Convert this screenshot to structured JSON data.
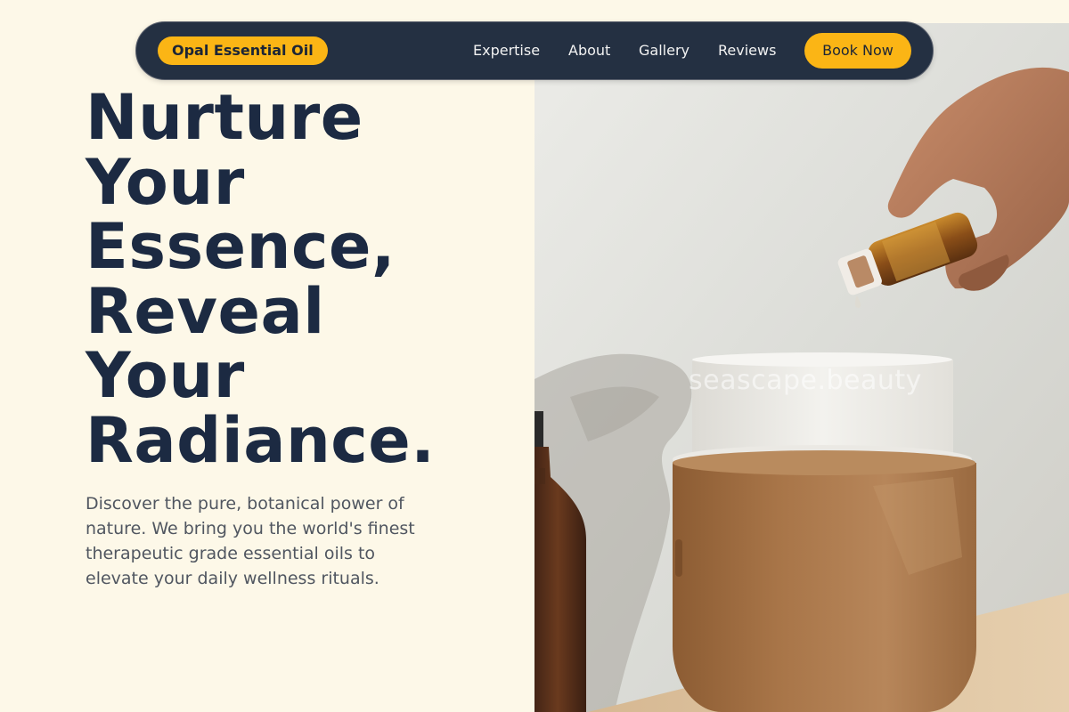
{
  "navbar": {
    "brand": "Opal Essential Oil",
    "links": [
      "Expertise",
      "About",
      "Gallery",
      "Reviews"
    ],
    "cta_label": "Book Now"
  },
  "hero": {
    "title_lines": [
      "Nurture",
      "Your",
      "Essence,",
      "Reveal",
      "Your",
      "Radiance."
    ],
    "description": "Discover the pure, botanical power of nature. We bring you the world's finest therapeutic grade essential oils to elevate your daily wellness rituals.",
    "image_watermark": "seascape.beauty"
  },
  "colors": {
    "page_background": "#fdf8e8",
    "navbar_background": "#243042",
    "accent": "#fbb515",
    "heading": "#1c2a42",
    "body_text": "#505660"
  }
}
